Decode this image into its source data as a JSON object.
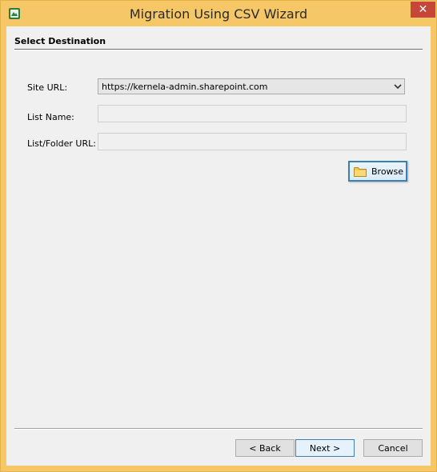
{
  "window": {
    "title": "Migration Using CSV Wizard",
    "close_label": "✕"
  },
  "section": {
    "title": "Select Destination"
  },
  "form": {
    "site_url_label": "Site URL:",
    "site_url_value": "https://kernela-admin.sharepoint.com",
    "list_name_label": "List Name:",
    "list_name_value": "",
    "folder_url_label": "List/Folder URL:",
    "folder_url_value": "",
    "browse_label": "Browse"
  },
  "footer": {
    "back_label": "< Back",
    "next_label": "Next >",
    "cancel_label": "Cancel"
  },
  "colors": {
    "titlebar": "#f6c767",
    "close": "#c7463a",
    "client": "#f0f0f0",
    "accent": "#3c7fb1"
  }
}
